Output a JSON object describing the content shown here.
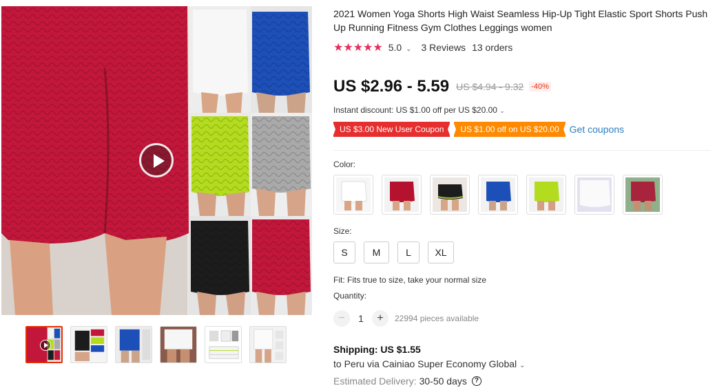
{
  "product": {
    "title": "2021 Women Yoga Shorts High Waist Seamless Hip-Up Tight Elastic Sport Shorts Push Up Running Fitness Gym Clothes Leggings women"
  },
  "rating": {
    "stars": "★★★★★",
    "value": "5.0",
    "reviews": "3 Reviews",
    "orders": "13 orders"
  },
  "price": {
    "current": "US $2.96 - 5.59",
    "original": "US $4.94 - 9.32",
    "discount": "-40%"
  },
  "promo": {
    "instant_discount": "Instant discount: US $1.00 off per US $20.00",
    "coupon_new_user": "US $3.00 New User Coupon",
    "coupon_off": "US $1.00 off on US $20.00",
    "get_coupons": "Get coupons"
  },
  "color": {
    "label": "Color:",
    "options": [
      {
        "color": "#f0f0f0"
      },
      {
        "color": "#b5122f"
      },
      {
        "color": "#1c1c1c"
      },
      {
        "color": "#1d4fb8"
      },
      {
        "color": "#b4dc1e"
      },
      {
        "color": "#f4f4f6"
      },
      {
        "color": "#a8243c"
      }
    ]
  },
  "size": {
    "label": "Size:",
    "options": [
      "S",
      "M",
      "L",
      "XL"
    ]
  },
  "fit": "Fit: Fits true to size, take your normal size",
  "quantity": {
    "label": "Quantity:",
    "minus": "−",
    "value": "1",
    "plus": "+",
    "available": "22994 pieces available"
  },
  "shipping": {
    "cost": "Shipping: US $1.55",
    "to": "to Peru via Cainiao Super Economy Global",
    "estimated_label": "Estimated Delivery:",
    "estimated_days": "30-50 days",
    "help_icon": "?"
  },
  "icons": {
    "caret": "⌄"
  }
}
